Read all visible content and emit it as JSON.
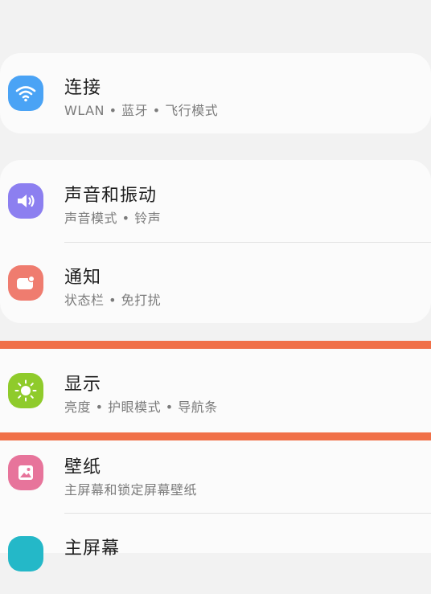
{
  "settings": {
    "items": [
      {
        "title": "连接",
        "subtitle": "WLAN • 蓝牙 • 飞行模式",
        "icon": "wifi-icon",
        "color": "#4aa3f5"
      },
      {
        "title": "声音和振动",
        "subtitle": "声音模式 • 铃声",
        "icon": "speaker-icon",
        "color": "#8c7ff0"
      },
      {
        "title": "通知",
        "subtitle": "状态栏 • 免打扰",
        "icon": "notification-icon",
        "color": "#ef7c6f"
      },
      {
        "title": "显示",
        "subtitle": "亮度 • 护眼模式 • 导航条",
        "icon": "brightness-icon",
        "color": "#8fcb2b"
      },
      {
        "title": "壁纸",
        "subtitle": "主屏幕和锁定屏幕壁纸",
        "icon": "image-icon",
        "color": "#e7749b"
      },
      {
        "title": "主屏幕",
        "subtitle": "",
        "icon": "home-screen-icon",
        "color": "#24b8c8"
      }
    ]
  },
  "highlight": {
    "color": "#f07048"
  }
}
